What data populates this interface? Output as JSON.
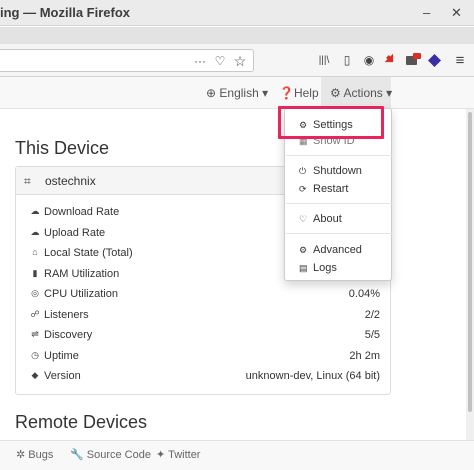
{
  "window": {
    "title": "ing — Mozilla Firefox",
    "minimize": "–",
    "close": "✕"
  },
  "toolbar": {
    "icons": [
      "more-icon",
      "pocket-icon",
      "bookmark-star-icon",
      "library-icon",
      "sidebar-icon",
      "account-icon",
      "arrow-icon",
      "extension-icon",
      "extension2-icon",
      "menu-icon"
    ],
    "more": "···",
    "pocket": "♡",
    "star": "☆",
    "library": "|||\\",
    "sidebar": "▯",
    "account": "◉",
    "menu": "≡"
  },
  "navbar": {
    "language": "English",
    "help": "Help",
    "actions": "Actions",
    "caret": "▾"
  },
  "this_device": {
    "heading": "This Device",
    "name": "ostechnix",
    "stats": [
      {
        "icon": "cloud-download-icon",
        "glyph": "☁",
        "label": "Download Rate",
        "value": ""
      },
      {
        "icon": "cloud-upload-icon",
        "glyph": "☁",
        "label": "Upload Rate",
        "value": ""
      },
      {
        "icon": "home-icon",
        "glyph": "⌂",
        "label": "Local State (Total)",
        "value": ""
      },
      {
        "icon": "ram-icon",
        "glyph": "▮",
        "label": "RAM Utilization",
        "value": ""
      },
      {
        "icon": "cpu-icon",
        "glyph": "◎",
        "label": "CPU Utilization",
        "value": "0.04%"
      },
      {
        "icon": "listeners-icon",
        "glyph": "☍",
        "label": "Listeners",
        "value": "2/2"
      },
      {
        "icon": "discovery-icon",
        "glyph": "⇌",
        "label": "Discovery",
        "value": "5/5"
      },
      {
        "icon": "uptime-icon",
        "glyph": "◷",
        "label": "Uptime",
        "value": "2h 2m"
      },
      {
        "icon": "version-icon",
        "glyph": "◆",
        "label": "Version",
        "value": "unknown-dev, Linux (64 bit)"
      }
    ]
  },
  "remote": {
    "heading": "Remote Devices"
  },
  "footer": {
    "bugs": "Bugs",
    "source": "Source Code",
    "twitter": "Twitter"
  },
  "menu": {
    "settings": "Settings",
    "show_id": "Show ID",
    "shutdown": "Shutdown",
    "restart": "Restart",
    "about": "About",
    "advanced": "Advanced",
    "logs": "Logs"
  },
  "colors": {
    "highlight": "#e8245b",
    "arrow": "#d93025",
    "extension": "#3b2fa8"
  }
}
